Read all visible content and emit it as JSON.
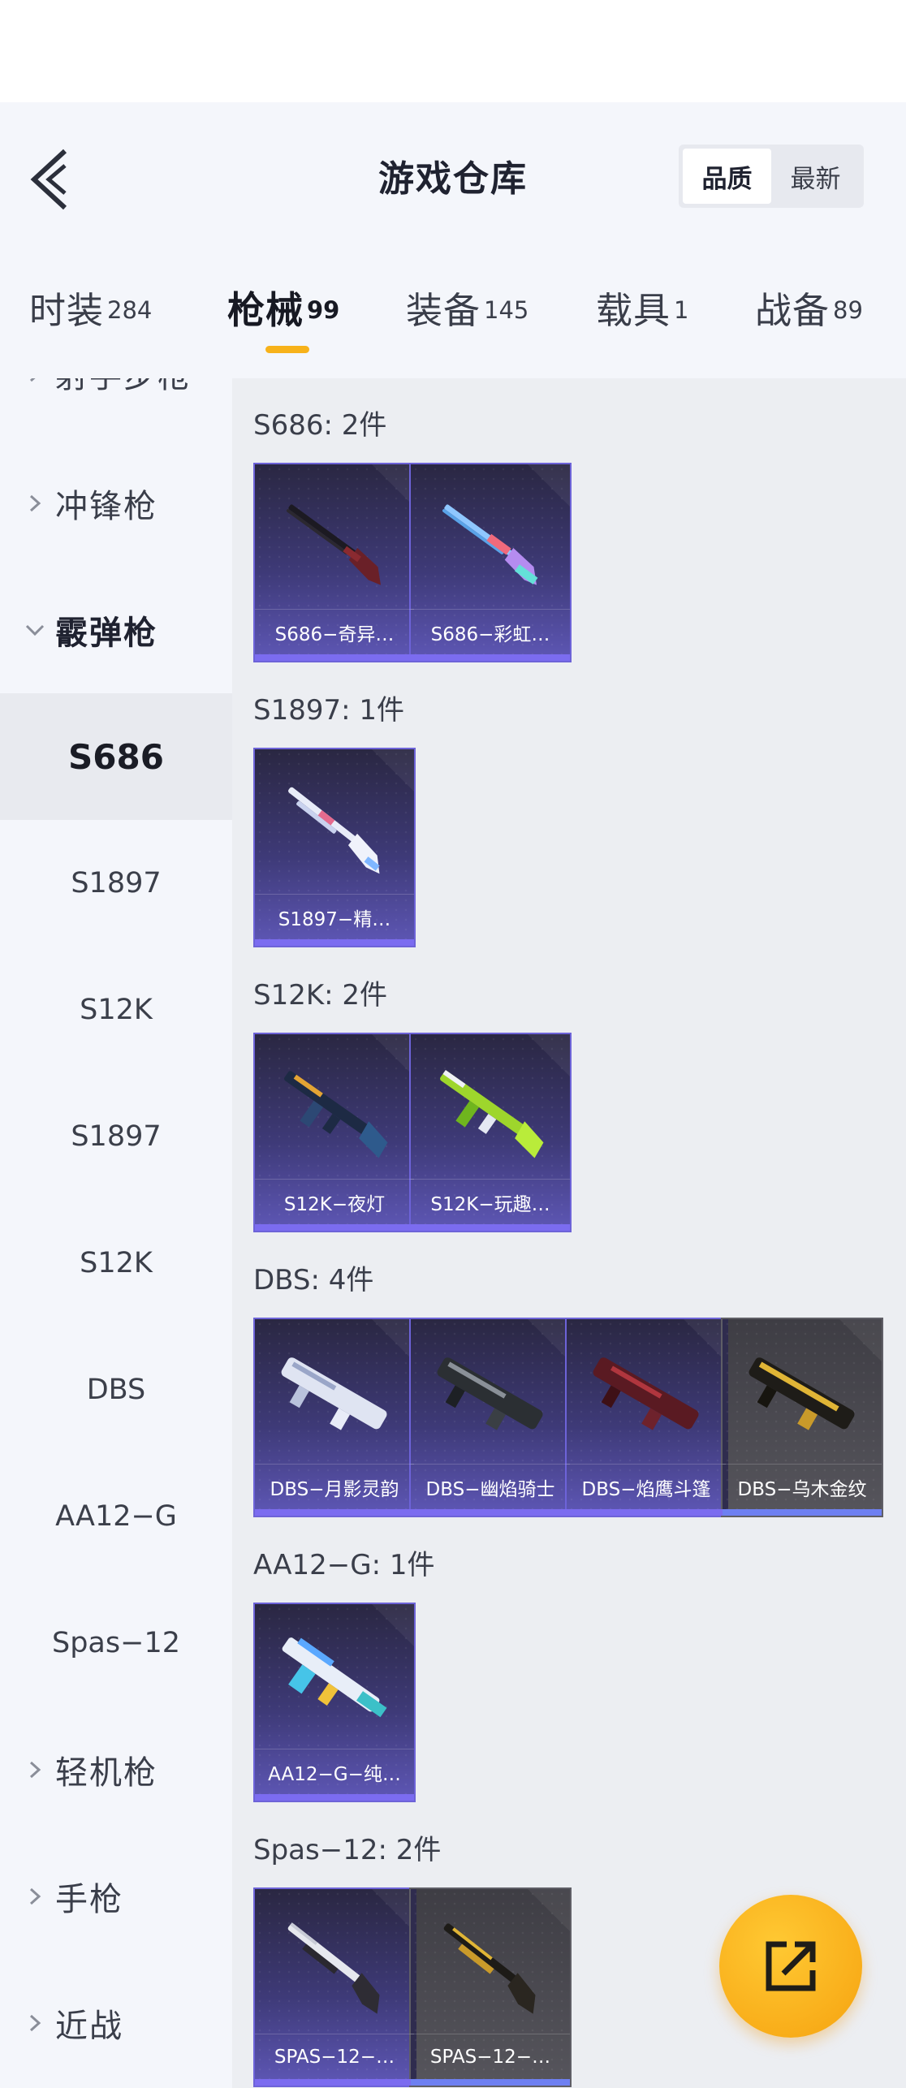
{
  "header": {
    "title": "游戏仓库",
    "sort_options": [
      "品质",
      "最新"
    ],
    "sort_selected": "品质"
  },
  "tabs": [
    {
      "label": "时装",
      "count": "284"
    },
    {
      "label": "枪械",
      "count": "99"
    },
    {
      "label": "装备",
      "count": "145"
    },
    {
      "label": "载具",
      "count": "1"
    },
    {
      "label": "战备",
      "count": "89"
    }
  ],
  "active_tab": "枪械",
  "sidebar": {
    "partial_top_label": "射手步枪",
    "categories": {
      "smg": "冲锋枪",
      "shotgun": "霰弹枪",
      "lmg": "轻机枪",
      "pistol": "手枪",
      "melee": "近战"
    },
    "subs": [
      "S686",
      "S1897",
      "S12K",
      "S1897",
      "S12K",
      "DBS",
      "AA12−G",
      "Spas−12"
    ],
    "selected_sub": "S686"
  },
  "sections": [
    {
      "title": "S686: 2件",
      "items": [
        "S686−奇异…",
        "S686−彩虹…"
      ]
    },
    {
      "title": "S1897: 1件",
      "items": [
        "S1897−精…"
      ]
    },
    {
      "title": "S12K: 2件",
      "items": [
        "S12K−夜灯",
        "S12K−玩趣…"
      ]
    },
    {
      "title": "DBS: 4件",
      "items": [
        "DBS−月影灵韵",
        "DBS−幽焰骑士",
        "DBS−焰鹰斗篷",
        "DBS−乌木金纹"
      ]
    },
    {
      "title": "AA12−G: 1件",
      "items": [
        "AA12−G−纯…"
      ]
    },
    {
      "title": "Spas−12: 2件",
      "items": [
        "SPAS−12−…",
        "SPAS−12−…"
      ]
    }
  ],
  "colors": {
    "accent": "#f7b21a",
    "card_purple": "#5e57b6",
    "card_gold_bg": "#56555c",
    "share_button": "#f6a20f"
  },
  "icons": {
    "back": "back-chevron-icon",
    "share": "share-out-icon",
    "collapsed": "chevron-right-icon",
    "expanded": "chevron-down-icon"
  }
}
